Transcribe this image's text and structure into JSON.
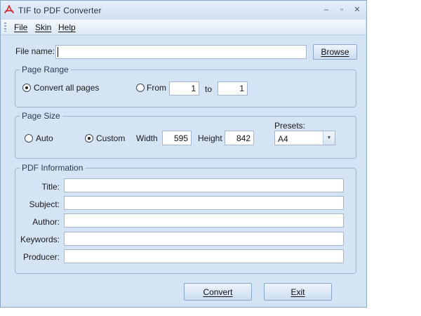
{
  "window": {
    "title": "TIF to PDF Converter",
    "controls": {
      "minimize": "‒",
      "maximize": "▫",
      "close": "✕"
    }
  },
  "menu": {
    "file": "File",
    "skin": "Skin",
    "help": "Help"
  },
  "file": {
    "label": "File name:",
    "value": "",
    "browse_label": "Browse"
  },
  "page_range": {
    "title": "Page Range",
    "convert_all_label": "Convert all pages",
    "from_label": "From",
    "from_value": "1",
    "to_label": "to",
    "to_value": "1",
    "selected": "convert_all"
  },
  "page_size": {
    "title": "Page Size",
    "auto_label": "Auto",
    "custom_label": "Custom",
    "width_label": "Width",
    "width_value": "595",
    "height_label": "Height",
    "height_value": "842",
    "presets_label": "Presets:",
    "preset_value": "A4",
    "selected": "custom"
  },
  "pdf_info": {
    "title": "PDF Information",
    "title_label": "Title:",
    "subject_label": "Subject:",
    "author_label": "Author:",
    "keywords_label": "Keywords:",
    "producer_label": "Producer:"
  },
  "actions": {
    "convert_label": "Convert",
    "exit_label": "Exit"
  },
  "colors": {
    "window_bg": "#d5e4f5",
    "border": "#8aa6c8",
    "pdf_red": "#d4262b"
  }
}
